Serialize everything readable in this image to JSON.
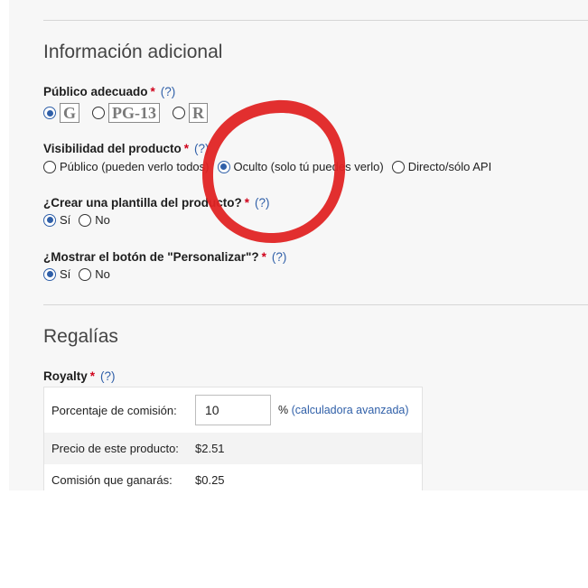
{
  "sections": {
    "additional_info": {
      "title": "Información adicional",
      "audience": {
        "label": "Público adecuado",
        "required": "*",
        "help": "(?)",
        "options": [
          {
            "label": "G",
            "selected": true
          },
          {
            "label": "PG-13",
            "selected": false
          },
          {
            "label": "R",
            "selected": false
          }
        ]
      },
      "visibility": {
        "label": "Visibilidad del producto",
        "required": "*",
        "help": "(?)",
        "options": [
          {
            "label": "Público (pueden verlo todos)",
            "selected": false
          },
          {
            "label": "Oculto (solo tú puedes verlo)",
            "selected": true
          },
          {
            "label": "Directo/sólo API",
            "selected": false
          }
        ]
      },
      "template": {
        "label": "¿Crear una plantilla del producto?",
        "required": "*",
        "help": "(?)",
        "options": [
          {
            "label": "Sí",
            "selected": true
          },
          {
            "label": "No",
            "selected": false
          }
        ]
      },
      "customize": {
        "label": "¿Mostrar el botón de \"Personalizar\"?",
        "required": "*",
        "help": "(?)",
        "options": [
          {
            "label": "Sí",
            "selected": true
          },
          {
            "label": "No",
            "selected": false
          }
        ]
      }
    },
    "royalties": {
      "title": "Regalías",
      "royalty": {
        "label": "Royalty",
        "required": "*",
        "help": "(?)"
      },
      "table": {
        "commission_label": "Porcentaje de comisión:",
        "commission_value": "10",
        "percent_sign": "%",
        "calculator_link": "(calculadora avanzada)",
        "price_label": "Precio de este producto:",
        "price_value": "$2.51",
        "earnings_label": "Comisión que ganarás:",
        "earnings_value": "$0.25"
      }
    }
  },
  "annotation": {
    "shape": "circle",
    "color": "#e02424"
  },
  "colors": {
    "accent": "#2f5fa8",
    "required": "#d0021b",
    "panel_bg": "#f7f7f7"
  }
}
